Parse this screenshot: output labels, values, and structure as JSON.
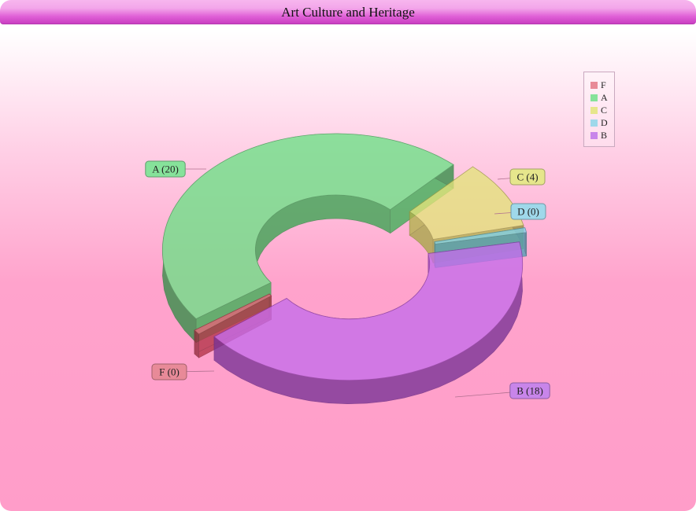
{
  "window": {
    "title": "Art Culture and Heritage"
  },
  "chart_data": {
    "type": "pie",
    "style": "3d-doughnut-exploded",
    "categories": [
      "F",
      "A",
      "C",
      "D",
      "B"
    ],
    "values": [
      0,
      20,
      4,
      0,
      18
    ],
    "data_labels": [
      "F (0)",
      "A (20)",
      "C (4)",
      "D (0)",
      "B (18)"
    ],
    "colors": [
      "#e0405a",
      "#4cdb6c",
      "#dede5e",
      "#63c7e4",
      "#b84de6"
    ],
    "legend": {
      "position": "top-right",
      "entries": [
        {
          "name": "F",
          "color": "#e88a98"
        },
        {
          "name": "A",
          "color": "#86e29a"
        },
        {
          "name": "C",
          "color": "#e6e68c"
        },
        {
          "name": "D",
          "color": "#9fd8ea"
        },
        {
          "name": "B",
          "color": "#c885ea"
        }
      ]
    }
  }
}
